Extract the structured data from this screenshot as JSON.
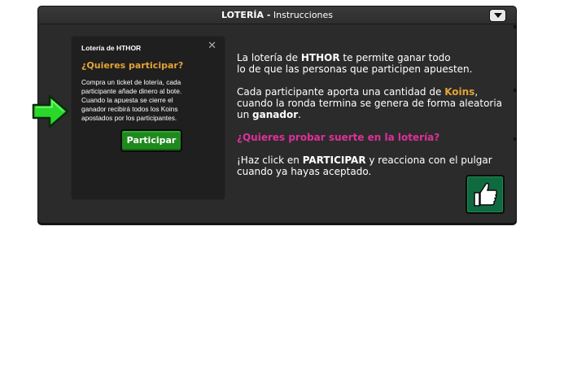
{
  "window": {
    "title_bold": "LOTERÍA -",
    "title_rest": " Instrucciones",
    "collapse_icon": "chevron-down-icon"
  },
  "card": {
    "title": "Lotería de HTHOR",
    "close_icon": "close-icon",
    "question": "¿Quieres participar?",
    "body_lines": [
      "Compra un ticket de lotería, cada",
      "participante añade dinero al bote.",
      "Cuando la apuesta se cierre el",
      "ganador recibirá todos los Koins",
      "apostados por los participantes."
    ],
    "button_label": "Participar"
  },
  "pointer_icon": "green-arrow-right-icon",
  "info": {
    "p1_a": "La lotería de ",
    "p1_b": "HTHOR",
    "p1_c": " te permite ganar todo",
    "p1_d": "lo de que las personas que participen apuesten.",
    "p2_a": "Cada participante aporta una cantidad de ",
    "p2_b": "Koins",
    "p2_c": ",",
    "p2_d": "cuando la ronda termina se genera de forma aleatoria",
    "p2_e": "un ",
    "p2_f": "ganador",
    "p2_g": ".",
    "p3": "¿Quieres probar suerte en la lotería?",
    "p4_a": "¡Haz click en ",
    "p4_b": "PARTICIPAR",
    "p4_c": " y reacciona con el pulgar",
    "p4_d": "cuando ya hayas aceptado."
  },
  "thumb_icon": "thumbs-up-icon",
  "colors": {
    "accent_orange": "#e5a336",
    "accent_pink": "#e02f9a",
    "button_green": "#1e8a1e",
    "thumb_bg": "#0f6a3f"
  }
}
